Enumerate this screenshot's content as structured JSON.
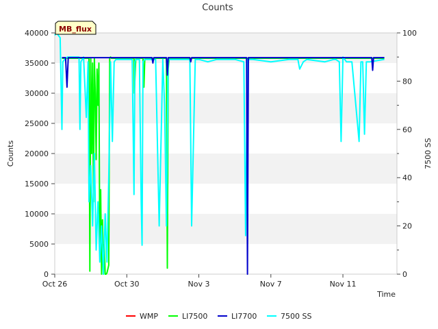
{
  "chart_data": {
    "type": "line",
    "title": "Counts",
    "xlabel": "Time",
    "ylabel": "Counts",
    "y2label": "7500 SS",
    "badge": "MB_flux",
    "xlim": [
      "2024-10-26",
      "2024-11-14"
    ],
    "ylim": [
      0,
      40000
    ],
    "y2lim": [
      0,
      100
    ],
    "x_ticks": [
      "Oct 26",
      "Oct 30",
      "Nov 3",
      "Nov 7",
      "Nov 11"
    ],
    "y_ticks": [
      "0",
      "5000",
      "10000",
      "15000",
      "20000",
      "25000",
      "30000",
      "35000",
      "40000"
    ],
    "y2_ticks": [
      "0",
      "20",
      "40",
      "60",
      "80",
      "100"
    ],
    "grid": "horizontal bands",
    "legend_placement": "bottom",
    "series": [
      {
        "name": "WMP",
        "color": "#ff0000",
        "axis": "left",
        "x": [],
        "values": []
      },
      {
        "name": "LI7500",
        "color": "#00ff00",
        "axis": "left",
        "x": [
          0.4,
          1.8,
          1.9,
          1.95,
          2.0,
          2.05,
          2.1,
          2.15,
          2.2,
          2.25,
          2.3,
          2.35,
          2.4,
          2.45,
          2.5,
          2.55,
          2.6,
          2.65,
          2.7,
          2.75,
          2.8,
          2.85,
          2.9,
          3.0,
          3.05,
          3.1,
          3.15,
          3.2,
          4.0,
          4.4,
          4.42,
          4.5,
          4.9,
          4.95,
          5.0,
          5.7,
          6.2,
          6.25,
          6.3,
          6.35,
          6.4,
          7.5,
          18.3
        ],
        "values": [
          35800,
          35800,
          35800,
          500,
          35800,
          20000,
          35000,
          12000,
          35800,
          30000,
          19000,
          34000,
          28000,
          35000,
          3000,
          14000,
          0,
          9000,
          0,
          5000,
          0,
          0,
          200,
          1500,
          35800,
          36000,
          35800,
          35800,
          35800,
          35800,
          30000,
          35800,
          35800,
          31000,
          35800,
          35800,
          35800,
          1000,
          34000,
          35800,
          35800,
          35800,
          35800
        ]
      },
      {
        "name": "LI7700",
        "color": "#0000cc",
        "axis": "left",
        "x": [
          0.4,
          0.6,
          0.68,
          0.75,
          5.4,
          5.45,
          5.5,
          5.8,
          6.2,
          6.25,
          6.3,
          7.5,
          7.55,
          7.6,
          10.65,
          10.7,
          10.75,
          11.5,
          17.3,
          17.6,
          17.65,
          17.7,
          18.3
        ],
        "values": [
          35900,
          35900,
          31000,
          35900,
          35900,
          35000,
          35900,
          35900,
          35900,
          33000,
          35900,
          35900,
          35200,
          35900,
          35900,
          0,
          35900,
          35900,
          35900,
          35900,
          33800,
          35900,
          35900
        ]
      },
      {
        "name": "7500 SS",
        "color": "#00ffff",
        "axis": "right",
        "x": [
          0.0,
          0.1,
          0.3,
          0.4,
          0.45,
          0.55,
          0.7,
          1.0,
          1.35,
          1.4,
          1.45,
          1.6,
          1.75,
          1.85,
          1.9,
          2.0,
          2.1,
          2.2,
          2.3,
          2.4,
          2.5,
          2.6,
          2.7,
          2.8,
          2.9,
          3.0,
          3.1,
          3.2,
          3.3,
          3.4,
          3.5,
          4.0,
          4.3,
          4.4,
          4.45,
          4.5,
          4.7,
          4.8,
          4.85,
          4.9,
          5.0,
          5.5,
          5.6,
          5.8,
          6.0,
          6.1,
          6.2,
          6.3,
          6.5,
          7.0,
          7.5,
          7.6,
          7.8,
          7.9,
          8.0,
          8.5,
          9.0,
          10.0,
          10.5,
          10.6,
          10.7,
          10.8,
          11.0,
          12.0,
          13.0,
          13.5,
          13.6,
          13.8,
          14.0,
          15.0,
          15.5,
          15.6,
          15.8,
          15.9,
          16.0,
          16.2,
          16.5,
          16.9,
          17.0,
          17.1,
          17.2,
          17.3,
          17.5,
          18.3
        ],
        "values": [
          99,
          100,
          98,
          60,
          88,
          89,
          90,
          90,
          90,
          60,
          88,
          90,
          65,
          88,
          30,
          45,
          20,
          50,
          10,
          30,
          5,
          20,
          0,
          25,
          5,
          40,
          88,
          55,
          88,
          89,
          89,
          89,
          89,
          33,
          88,
          89,
          89,
          30,
          12,
          88,
          89,
          89,
          89,
          20,
          89,
          70,
          20,
          89,
          89,
          89,
          89,
          20,
          89,
          89,
          89,
          88,
          89,
          89,
          88,
          16,
          89,
          89,
          89,
          88,
          89,
          89,
          85,
          88,
          89,
          88,
          89,
          89,
          88,
          55,
          90,
          88,
          88,
          55,
          88,
          88,
          58,
          88,
          88,
          89
        ]
      }
    ]
  }
}
